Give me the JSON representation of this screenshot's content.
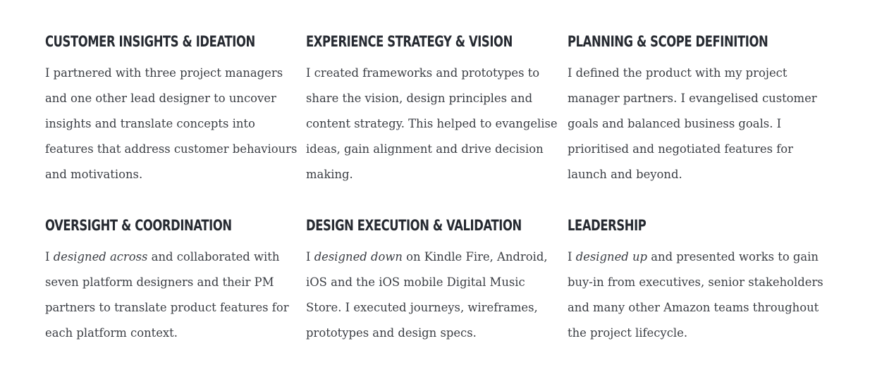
{
  "sections": [
    {
      "title": "CUSTOMER INSIGHTS & IDEATION",
      "text": "I partnered with three project managers and one other lead designer to uncover insights and translate concepts into features that address customer behaviours and motivations."
    },
    {
      "title": "EXPERIENCE STRATEGY & VISION",
      "text": "I created frameworks and prototypes to share the vision, design principles and content strategy. This helped to evangelise ideas, gain alignment and drive decision making."
    },
    {
      "title": "PLANNING & SCOPE DEFINITION",
      "text": "I defined the product with my project manager partners. I evangelised customer goals and balanced business goals. I prioritised and negotiated features for launch and beyond."
    },
    {
      "title": "OVERSIGHT & COORDINATION",
      "lead": "I ",
      "emphasis": "designed across",
      "text": " and collaborated with seven platform designers and their PM partners to translate product features for each platform context."
    },
    {
      "title": "DESIGN EXECUTION & VALIDATION",
      "lead": "I ",
      "emphasis": "designed down",
      "text": " on Kindle Fire, Android, iOS and the iOS mobile Digital Music Store. I executed journeys, wireframes, prototypes and design specs."
    },
    {
      "title": "LEADERSHIP",
      "lead": "I ",
      "emphasis": "designed up",
      "text": " and presented works to gain buy-in from executives, senior stakeholders and many other Amazon teams throughout the project lifecycle."
    }
  ]
}
